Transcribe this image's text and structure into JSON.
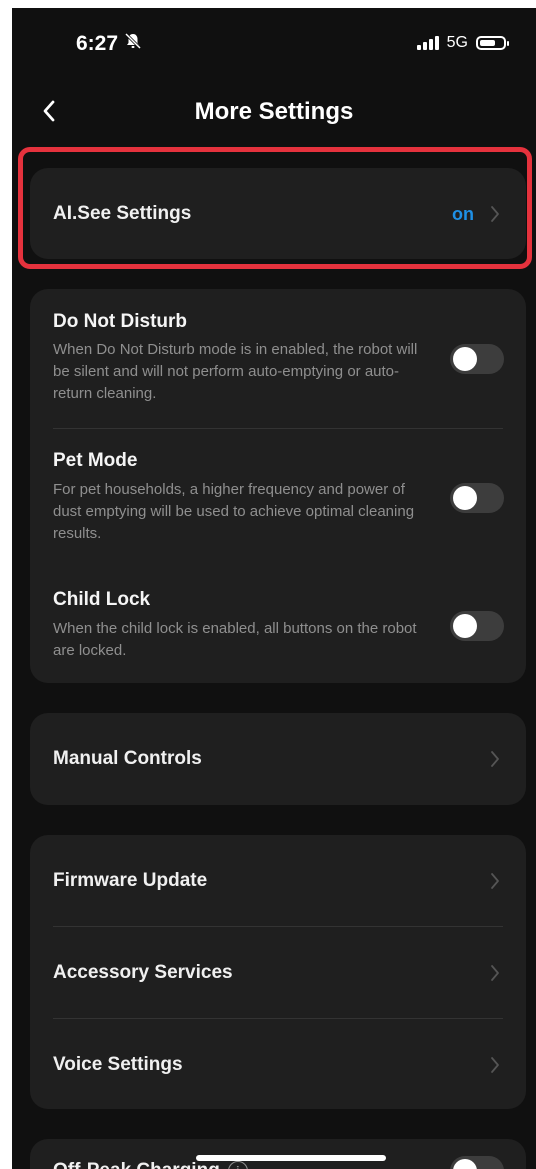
{
  "status_bar": {
    "time": "6:27",
    "network": "5G",
    "icons": [
      "bell-slash-icon",
      "signal-icon",
      "battery-icon"
    ]
  },
  "nav": {
    "title": "More Settings",
    "back_icon": "chevron-left-icon"
  },
  "ai_see": {
    "label": "AI.See Settings",
    "value": "on",
    "value_color": "#1e90e6"
  },
  "toggles": [
    {
      "title": "Do Not Disturb",
      "description": "When Do Not Disturb mode is in enabled, the robot will be silent and will not perform auto-emptying or auto-return cleaning.",
      "enabled": false
    },
    {
      "title": "Pet Mode",
      "description": "For pet households, a higher frequency and power of dust emptying will be used to achieve optimal cleaning results.",
      "enabled": false
    },
    {
      "title": "Child Lock",
      "description": "When the child lock is enabled, all buttons on the robot are locked.",
      "enabled": false
    }
  ],
  "manual_controls": {
    "label": "Manual Controls"
  },
  "device_menu": [
    {
      "label": "Firmware Update"
    },
    {
      "label": "Accessory Services"
    },
    {
      "label": "Voice Settings"
    }
  ],
  "off_peak": {
    "label": "Off-Peak Charging",
    "enabled": false
  },
  "colors": {
    "background": "#101010",
    "card": "#1f1f1f",
    "highlight": "#e5323d",
    "accent": "#1e90e6"
  }
}
